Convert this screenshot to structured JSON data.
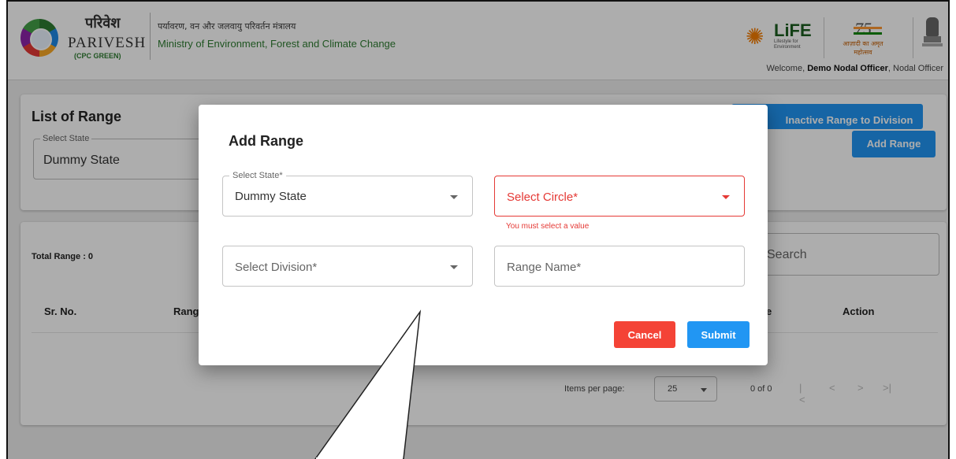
{
  "header": {
    "brand_hindi": "परिवेश",
    "brand_name": "PARIVESH",
    "brand_sub": "(CPC GREEN)",
    "ministry_hindi": "पर्यावरण, वन और जलवायु परिवर्तन मंत्रालय",
    "ministry_en": "Ministry of Environment, Forest and Climate Change",
    "life_logo": "LiFE",
    "life_sub": "Lifestyle for Environment",
    "azadi_number": "75",
    "azadi_text": "आज़ादी का अमृत महोत्सव",
    "welcome_prefix": "Welcome, ",
    "welcome_user": "Demo Nodal Officer",
    "welcome_role": ", Nodal Officer"
  },
  "page": {
    "title": "List of Range",
    "state_select_label": "Select State",
    "state_select_value": "Dummy State",
    "btn_inactive_range": "Inactive Range to Division",
    "btn_add_range": "Add Range",
    "total_range": "Total Range : 0",
    "search_placeholder": "Search",
    "columns": {
      "sr_no": "Sr. No.",
      "range": "Rang",
      "col_e": "e",
      "action": "Action"
    },
    "paginator": {
      "items_per_page_label": "Items per page:",
      "items_per_page_value": "25",
      "range_label": "0 of 0",
      "first": "|<",
      "prev": "<",
      "next": ">",
      "last": ">|"
    }
  },
  "dialog": {
    "title": "Add Range",
    "state_label": "Select State*",
    "state_value": "Dummy State",
    "circle_placeholder": "Select Circle*",
    "circle_error": "You must select a value",
    "division_placeholder": "Select Division*",
    "range_name_placeholder": "Range Name*",
    "cancel_label": "Cancel",
    "submit_label": "Submit"
  },
  "colors": {
    "primary": "#2196f3",
    "danger": "#f44336",
    "error_text": "#e53935",
    "brand_green": "#2e7d32"
  }
}
